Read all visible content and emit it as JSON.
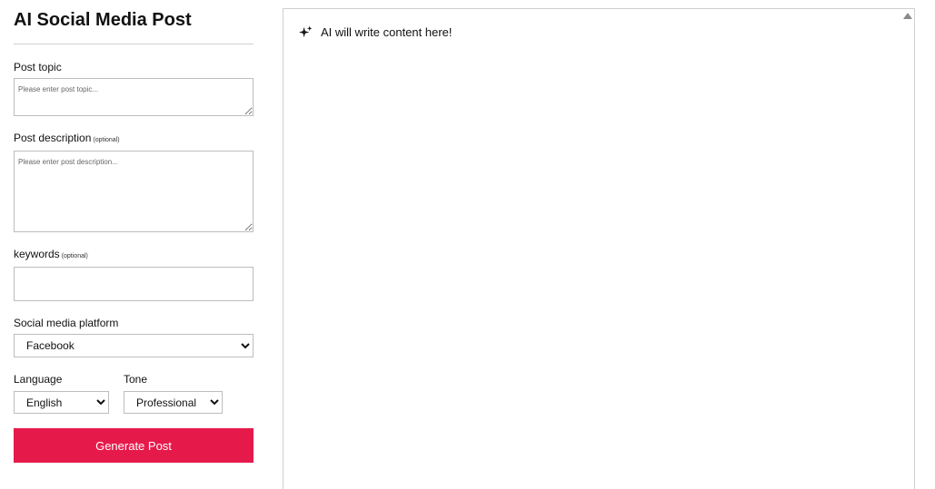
{
  "form": {
    "title": "AI Social Media Post",
    "topic": {
      "label": "Post topic",
      "placeholder": "Please enter post topic...",
      "value": ""
    },
    "description": {
      "label": "Post description",
      "optional": "(optional)",
      "placeholder": "Please enter post description...",
      "value": ""
    },
    "keywords": {
      "label": "keywords",
      "optional": "(optional)",
      "value": ""
    },
    "platform": {
      "label": "Social media platform",
      "selected": "Facebook"
    },
    "language": {
      "label": "Language",
      "selected": "English"
    },
    "tone": {
      "label": "Tone",
      "selected": "Professional"
    },
    "generate_label": "Generate Post"
  },
  "output": {
    "placeholder_text": "AI will write content here!",
    "icon": "sparkle-icon"
  },
  "colors": {
    "accent": "#e51a4b",
    "border": "#bdbdbd",
    "text": "#111111"
  }
}
